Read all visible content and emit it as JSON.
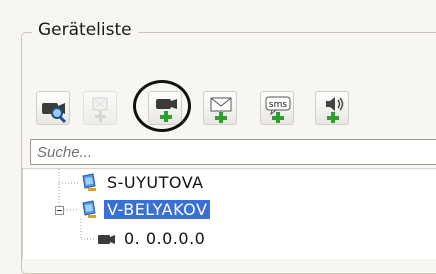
{
  "group": {
    "title": "Geräteliste"
  },
  "toolbar": {
    "buttons": [
      {
        "name": "camera-search-button",
        "icon": "camera-magnifier-icon",
        "enabled": true
      },
      {
        "name": "add-device-button",
        "icon": "generic-device-add-icon",
        "enabled": false
      },
      {
        "name": "add-camera-button",
        "icon": "camera-add-icon",
        "enabled": true,
        "highlighted": true
      },
      {
        "name": "add-email-button",
        "icon": "envelope-add-icon",
        "enabled": true
      },
      {
        "name": "add-sms-button",
        "icon": "sms-add-icon",
        "enabled": true,
        "badge_text": "sms"
      },
      {
        "name": "add-audio-button",
        "icon": "speaker-add-icon",
        "enabled": true
      }
    ]
  },
  "search": {
    "placeholder": "Suche..."
  },
  "tree": {
    "nodes": [
      {
        "label": "S-UYUTOVA",
        "icon": "computer-icon",
        "selected": false
      },
      {
        "label": "V-BELYAKOV",
        "icon": "computer-icon",
        "selected": true,
        "expanded": true
      },
      {
        "label": "0. 0.0.0.0",
        "icon": "camera-icon",
        "selected": false
      }
    ]
  },
  "colors": {
    "selection": "#3a6fd8",
    "plus_green": "#2e9e2e"
  }
}
